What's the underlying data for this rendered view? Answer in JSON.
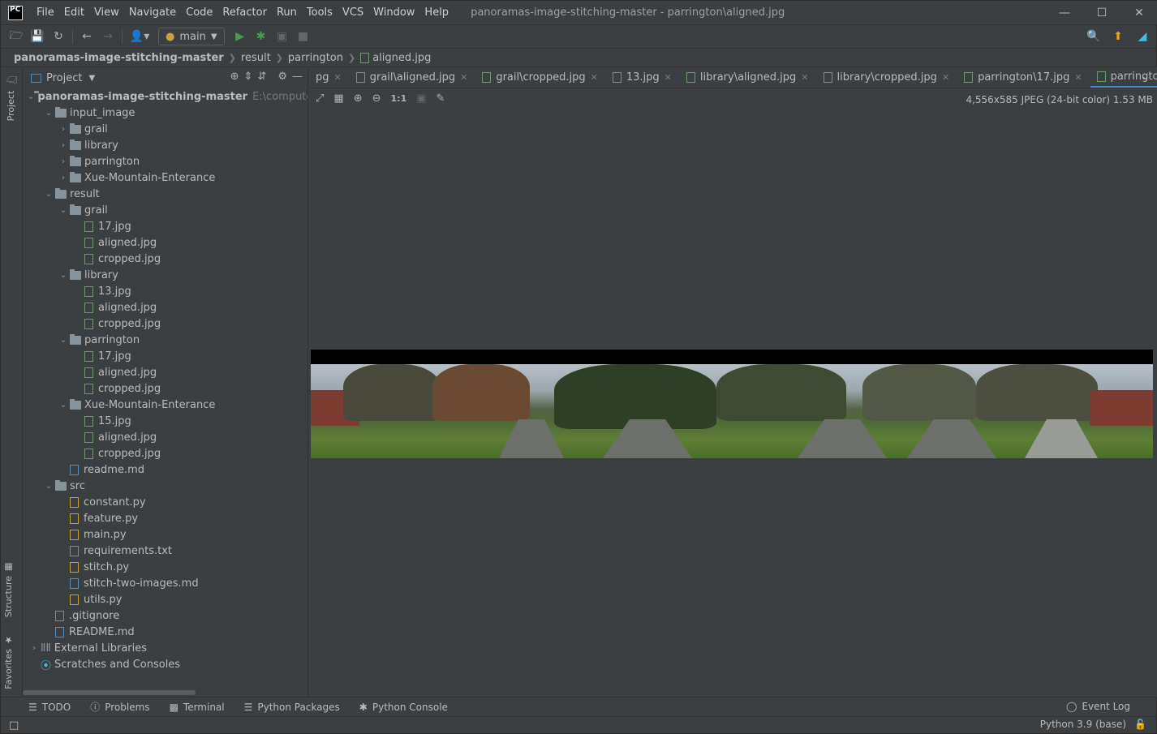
{
  "app": {
    "logo_text": "PC",
    "window_title": "panoramas-image-stitching-master - parrington\\aligned.jpg"
  },
  "menu": [
    "File",
    "Edit",
    "View",
    "Navigate",
    "Code",
    "Refactor",
    "Run",
    "Tools",
    "VCS",
    "Window",
    "Help"
  ],
  "toolbar": {
    "run_config": "main"
  },
  "breadcrumb": [
    "panoramas-image-stitching-master",
    "result",
    "parrington",
    "aligned.jpg"
  ],
  "side_tabs": {
    "project": "Project",
    "structure": "Structure",
    "favorites": "Favorites"
  },
  "project_panel": {
    "title": "Project",
    "root_name": "panoramas-image-stitching-master",
    "root_path": "E:\\computervisi",
    "tree": [
      {
        "label": "input_image",
        "type": "folder",
        "depth": 1,
        "expanded": true
      },
      {
        "label": "grail",
        "type": "folder",
        "depth": 2,
        "expanded": false
      },
      {
        "label": "library",
        "type": "folder",
        "depth": 2,
        "expanded": false
      },
      {
        "label": "parrington",
        "type": "folder",
        "depth": 2,
        "expanded": false
      },
      {
        "label": "Xue-Mountain-Enterance",
        "type": "folder",
        "depth": 2,
        "expanded": false
      },
      {
        "label": "result",
        "type": "folder",
        "depth": 1,
        "expanded": true
      },
      {
        "label": "grail",
        "type": "folder",
        "depth": 2,
        "expanded": true
      },
      {
        "label": "17.jpg",
        "type": "image",
        "depth": 3
      },
      {
        "label": "aligned.jpg",
        "type": "image",
        "depth": 3
      },
      {
        "label": "cropped.jpg",
        "type": "image",
        "depth": 3
      },
      {
        "label": "library",
        "type": "folder",
        "depth": 2,
        "expanded": true
      },
      {
        "label": "13.jpg",
        "type": "image",
        "depth": 3
      },
      {
        "label": "aligned.jpg",
        "type": "image",
        "depth": 3
      },
      {
        "label": "cropped.jpg",
        "type": "image",
        "depth": 3
      },
      {
        "label": "parrington",
        "type": "folder",
        "depth": 2,
        "expanded": true
      },
      {
        "label": "17.jpg",
        "type": "image",
        "depth": 3
      },
      {
        "label": "aligned.jpg",
        "type": "image",
        "depth": 3
      },
      {
        "label": "cropped.jpg",
        "type": "image",
        "depth": 3
      },
      {
        "label": "Xue-Mountain-Enterance",
        "type": "folder",
        "depth": 2,
        "expanded": true
      },
      {
        "label": "15.jpg",
        "type": "image",
        "depth": 3
      },
      {
        "label": "aligned.jpg",
        "type": "image",
        "depth": 3
      },
      {
        "label": "cropped.jpg",
        "type": "image",
        "depth": 3
      },
      {
        "label": "readme.md",
        "type": "md",
        "depth": 2
      },
      {
        "label": "src",
        "type": "folder",
        "depth": 1,
        "expanded": true
      },
      {
        "label": "constant.py",
        "type": "py",
        "depth": 2
      },
      {
        "label": "feature.py",
        "type": "py",
        "depth": 2
      },
      {
        "label": "main.py",
        "type": "py",
        "depth": 2
      },
      {
        "label": "requirements.txt",
        "type": "txt",
        "depth": 2
      },
      {
        "label": "stitch.py",
        "type": "py",
        "depth": 2
      },
      {
        "label": "stitch-two-images.md",
        "type": "md",
        "depth": 2
      },
      {
        "label": "utils.py",
        "type": "py",
        "depth": 2
      },
      {
        "label": ".gitignore",
        "type": "git",
        "depth": 1
      },
      {
        "label": "README.md",
        "type": "md",
        "depth": 1
      }
    ],
    "external_libraries": "External Libraries",
    "scratches": "Scratches and Consoles"
  },
  "editor_tabs": [
    {
      "label": "pg",
      "active": false
    },
    {
      "label": "grail\\aligned.jpg",
      "active": false
    },
    {
      "label": "grail\\cropped.jpg",
      "active": false
    },
    {
      "label": "13.jpg",
      "active": false
    },
    {
      "label": "library\\aligned.jpg",
      "active": false
    },
    {
      "label": "library\\cropped.jpg",
      "active": false
    },
    {
      "label": "parrington\\17.jpg",
      "active": false
    },
    {
      "label": "parrington\\alic",
      "active": true
    }
  ],
  "image_viewer": {
    "zoom_actual": "1:1",
    "info": "4,556x585 JPEG (24-bit color) 1.53 MB"
  },
  "bottom_tabs": [
    "TODO",
    "Problems",
    "Terminal",
    "Python Packages",
    "Python Console"
  ],
  "event_log": "Event Log",
  "status": {
    "interpreter": "Python 3.9 (base)"
  },
  "colors": {
    "background": "#3c3f41",
    "accent": "#4a88c7",
    "run_green": "#499c54"
  }
}
